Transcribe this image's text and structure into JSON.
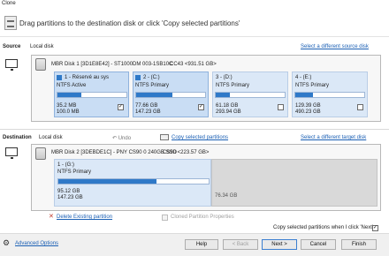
{
  "window": {
    "title": "Clone"
  },
  "instruction": "Drag partitions to the destination disk or click 'Copy selected partitions'",
  "source": {
    "label": "Source",
    "local_label": "Local disk",
    "select_link": "Select a different source disk",
    "disk_line1": "MBR Disk 1 [3D1E8E42] - ST1000DM 003-1SB10C",
    "disk_line1b": "CC43  <931.51 GB>",
    "partitions": [
      {
        "title": "1 - Réservé au sys",
        "type": "NTFS Active",
        "used": "35.2 MB",
        "total": "100.0 MB",
        "fill": 0.35,
        "checked": true,
        "has_win": true
      },
      {
        "title": "2 - (C:)",
        "type": "NTFS Primary",
        "used": "77.66 GB",
        "total": "147.23 GB",
        "fill": 0.53,
        "checked": true,
        "has_win": true
      },
      {
        "title": "3 - (D:)",
        "type": "NTFS Primary",
        "used": "61.18 GB",
        "total": "293.94 GB",
        "fill": 0.21,
        "checked": false,
        "has_win": false
      },
      {
        "title": "4 - (E:)",
        "type": "NTFS Primary",
        "used": "129.39 GB",
        "total": "490.23 GB",
        "fill": 0.26,
        "checked": false,
        "has_win": false
      }
    ]
  },
  "destination": {
    "label": "Destination",
    "local_label": "Local disk",
    "undo_label": "Undo",
    "copy_link": "Copy selected partitions",
    "select_link": "Select a different target disk",
    "disk_line1": "MBR Disk 2 [3DEBDE1C] - PNY CS90 0 240GB SSD",
    "disk_line1b": "CS90  <223.57 GB>",
    "partition": {
      "title": "1 - (G:)",
      "type": "NTFS Primary",
      "used": "95.12 GB",
      "total": "147.23 GB",
      "fill": 0.65
    },
    "free": "76.34 GB"
  },
  "actions": {
    "delete_link": "Delete Existing partition",
    "cloned_props": "Cloned Partition Properties",
    "copy_when_next": "Copy selected partitions when I click 'Next'"
  },
  "footer": {
    "advanced": "Advanced Options",
    "help": "Help",
    "back": "< Back",
    "next": "Next >",
    "cancel": "Cancel",
    "finish": "Finish"
  }
}
